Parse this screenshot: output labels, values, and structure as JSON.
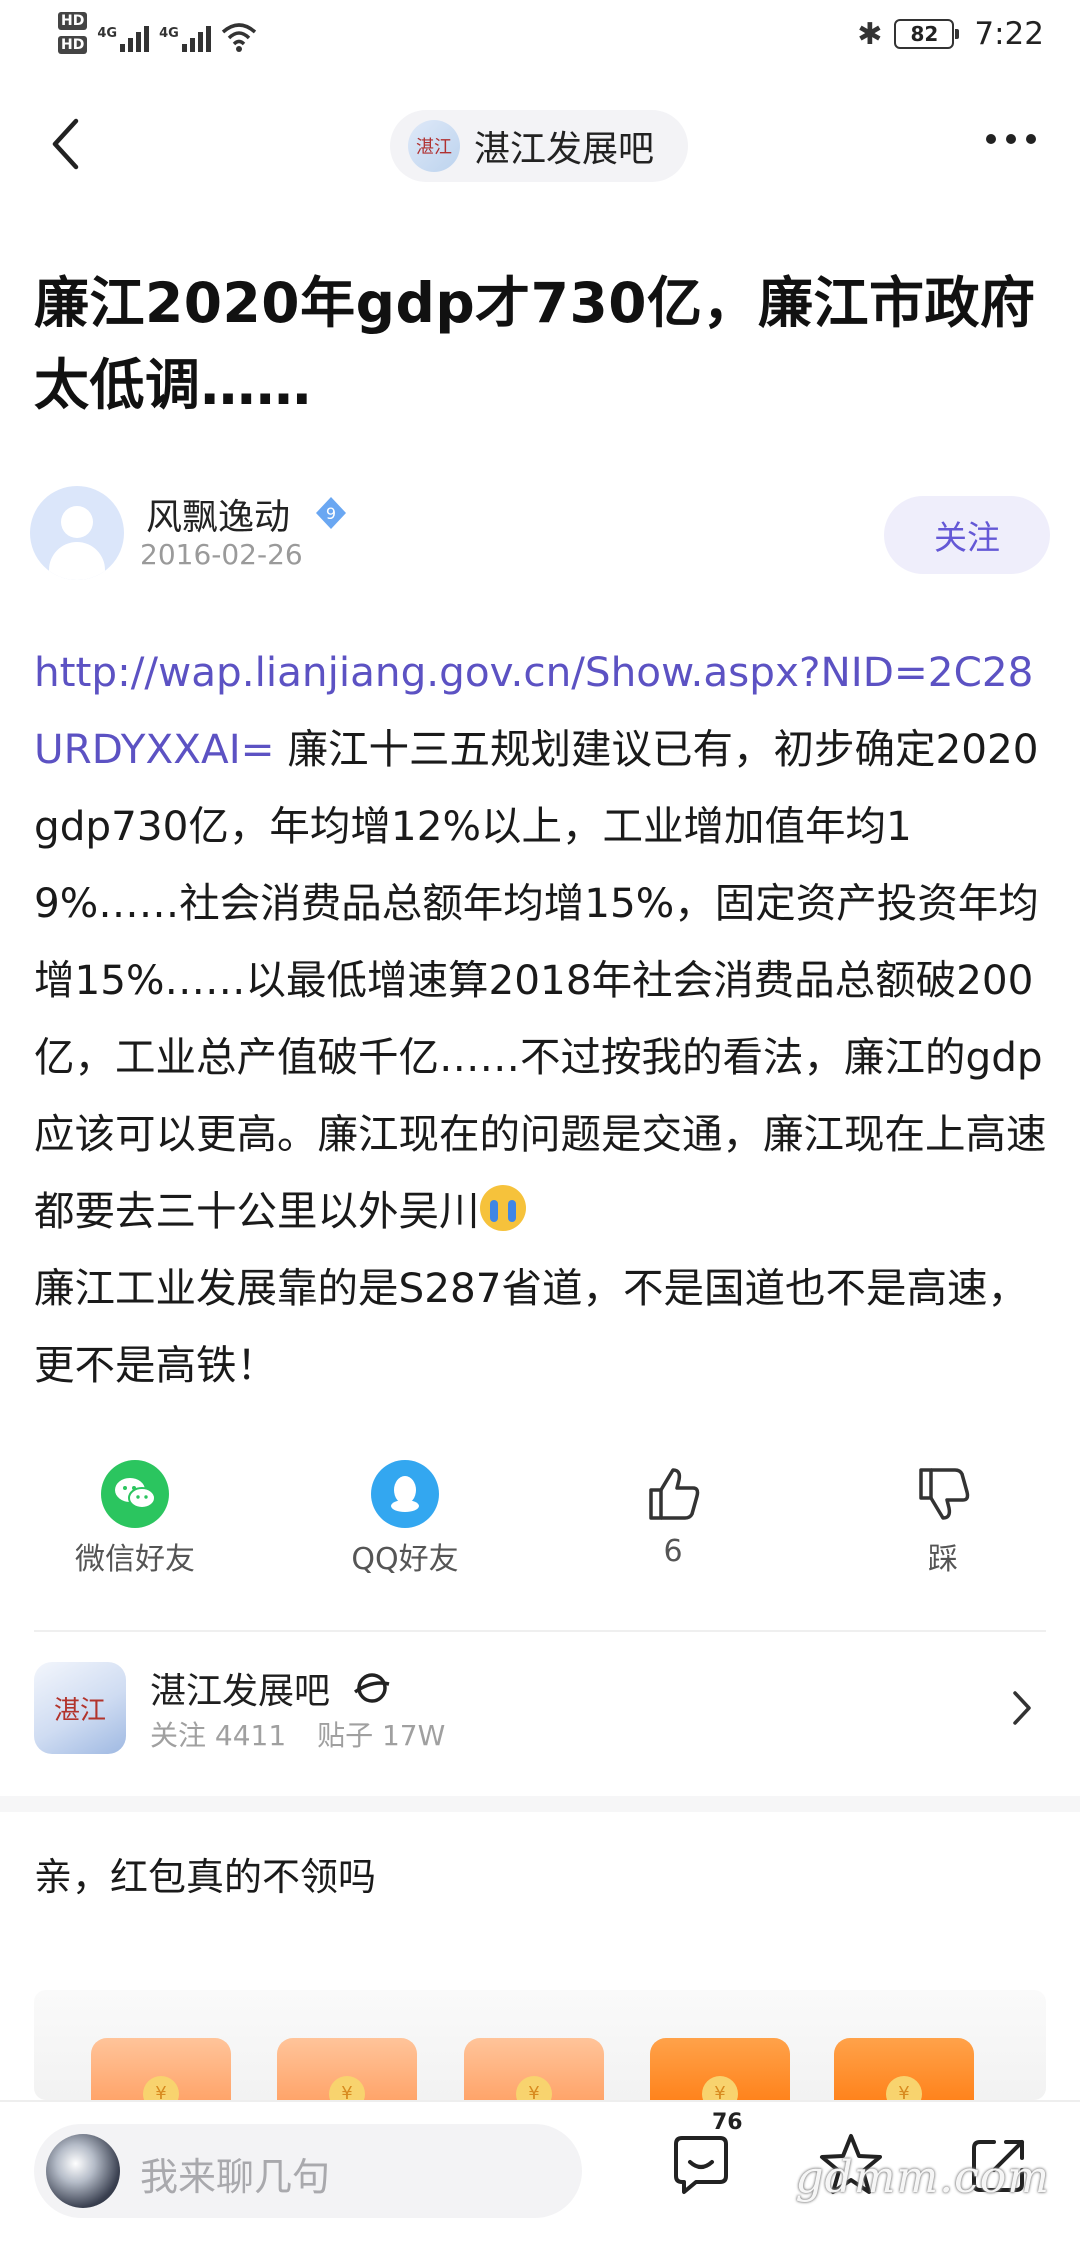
{
  "status_bar": {
    "hd1": "HD",
    "hd2": "HD",
    "net1": "4G",
    "net2": "4G",
    "battery": "82",
    "time": "7:22"
  },
  "nav": {
    "forum_name": "湛江发展吧",
    "logo_text": "湛江"
  },
  "post": {
    "title": "廉江2020年gdp才730亿，廉江市政府太低调……",
    "author": {
      "name": "风飘逸动",
      "level": "9",
      "date": "2016-02-26",
      "follow_label": "关注"
    },
    "link": "http://wap.lianjiang.gov.cn/Show.aspx?NID=2C28URDYXXAI=",
    "body_part1": " 廉江十三五规划建议已有，初步确定2020gdp730亿，年均增12%以上，工业增加值年均19%……社会消费品总额年均增15%，固定资产投资年均增15%……以最低增速算2018年社会消费品总额破200亿，工业总产值破千亿……不过按我的看法，廉江的gdp应该可以更高。廉江现在的问题是交通，廉江现在上高速都要去三十公里以外吴川",
    "emoji": "loudly-crying-face",
    "body_part2": "廉江工业发展靠的是S287省道，不是国道也不是高速，更不是高铁！"
  },
  "actions": {
    "wechat_label": "微信好友",
    "qq_label": "QQ好友",
    "like_count": "6",
    "dislike_label": "踩"
  },
  "forum_card": {
    "name": "湛江发展吧",
    "logo_text": "湛江",
    "followers_label": "关注 4411",
    "posts_label": "贴子 17W"
  },
  "red_packet": {
    "title": "亲，红包真的不领吗",
    "coin_symbol": "¥",
    "colors": [
      "#ffb07c",
      "#ffb07c",
      "#ffb07c",
      "#ff8a1e",
      "#ff8a1e"
    ]
  },
  "bottom_bar": {
    "input_placeholder": "我来聊几句",
    "comment_count": "76",
    "watermark": "gdmm.com"
  },
  "colors": {
    "accent": "#5c52c3",
    "follow_bg": "#efeefb",
    "wechat": "#2bc55f",
    "qq": "#33a7f0"
  }
}
